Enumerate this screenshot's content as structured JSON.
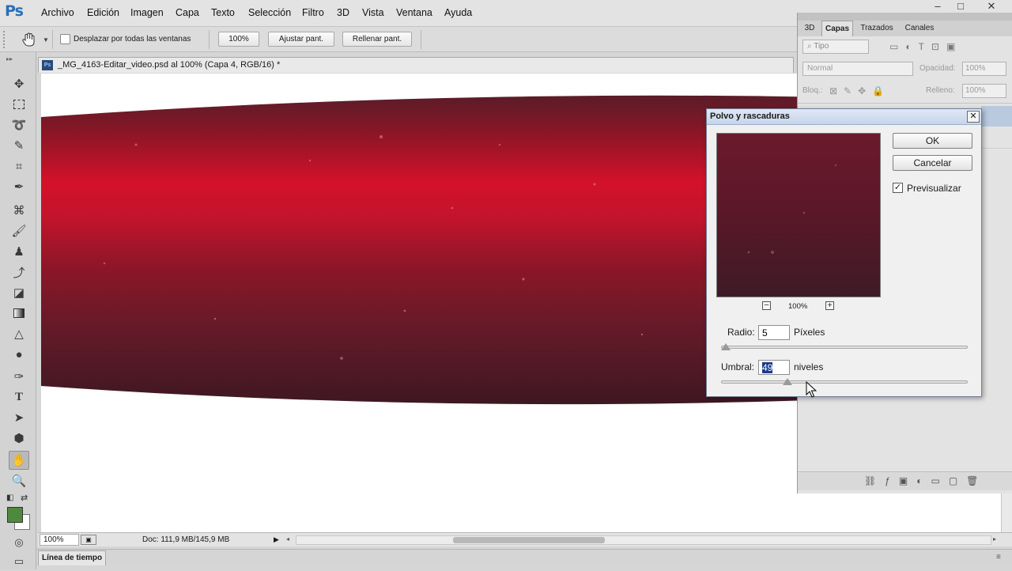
{
  "app": {
    "logo": "Ps"
  },
  "menu": [
    "Archivo",
    "Edición",
    "Imagen",
    "Capa",
    "Texto",
    "Selección",
    "Filtro",
    "3D",
    "Vista",
    "Ventana",
    "Ayuda"
  ],
  "window_controls": {
    "minimize": "–",
    "maximize": "□",
    "close": "✕"
  },
  "options_bar": {
    "scroll_all_label": "Desplazar por todas las ventanas",
    "zoom_btn": "100%",
    "fit_btn": "Ajustar pant.",
    "fill_btn": "Rellenar pant."
  },
  "document": {
    "tab_title": "_MG_4163-Editar_video.psd al 100% (Capa 4, RGB/16) *",
    "zoom": "100%",
    "doc_info": "Doc: 111,9 MB/145,9 MB"
  },
  "timeline": {
    "label": "Línea de tiempo"
  },
  "layers_panel": {
    "tabs": [
      "3D",
      "Capas",
      "Trazados",
      "Canales"
    ],
    "active_tab": "Capas",
    "filter_placeholder": "Tipo",
    "blend_mode": "Normal",
    "opacity_label": "Opacidad:",
    "opacity_value": "100%",
    "lock_label": "Bloq.:",
    "fill_label": "Relleno:",
    "fill_value": "100%"
  },
  "dialog": {
    "title": "Polvo y rascaduras",
    "ok": "OK",
    "cancel": "Cancelar",
    "preview_label": "Previsualizar",
    "preview_checked": true,
    "preview_zoom": "100%",
    "radius_label": "Radio:",
    "radius_value": "5",
    "radius_unit": "Píxeles",
    "threshold_label": "Umbral:",
    "threshold_value": "49",
    "threshold_unit": "niveles",
    "radius_slider": 0.02,
    "threshold_slider": 0.27
  },
  "colors": {
    "foreground": "#4f8a3c",
    "background": "#ffffff",
    "accent": "#2a6fb6"
  }
}
